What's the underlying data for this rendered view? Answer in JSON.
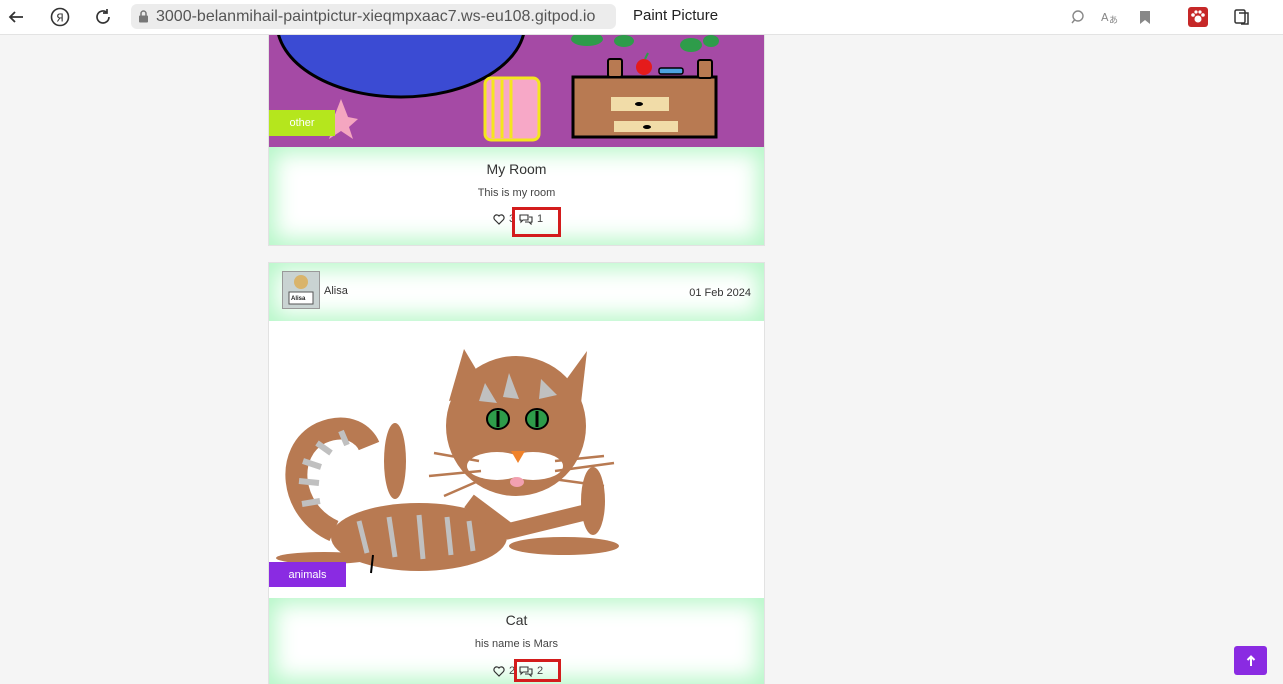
{
  "browser": {
    "url": "3000-belanmihail-paintpictur-xieqmpxaac7.ws-eu108.gitpod.io",
    "title": "Paint Picture"
  },
  "posts": [
    {
      "category": "other",
      "category_color": "#b5e61d",
      "title": "My Room",
      "description": "This is my room",
      "likes": "3",
      "comments": "1"
    },
    {
      "author": "Alisa",
      "avatar_text": "Alisa",
      "date": "01 Feb 2024",
      "category": "animals",
      "category_color": "#8a2be2",
      "title": "Cat",
      "description": "his name is Mars",
      "likes": "2",
      "comments": "2"
    }
  ],
  "colors": {
    "highlight": "#d31c1c",
    "accent": "#8a2be2",
    "card_glow": "#b6f7c8"
  }
}
